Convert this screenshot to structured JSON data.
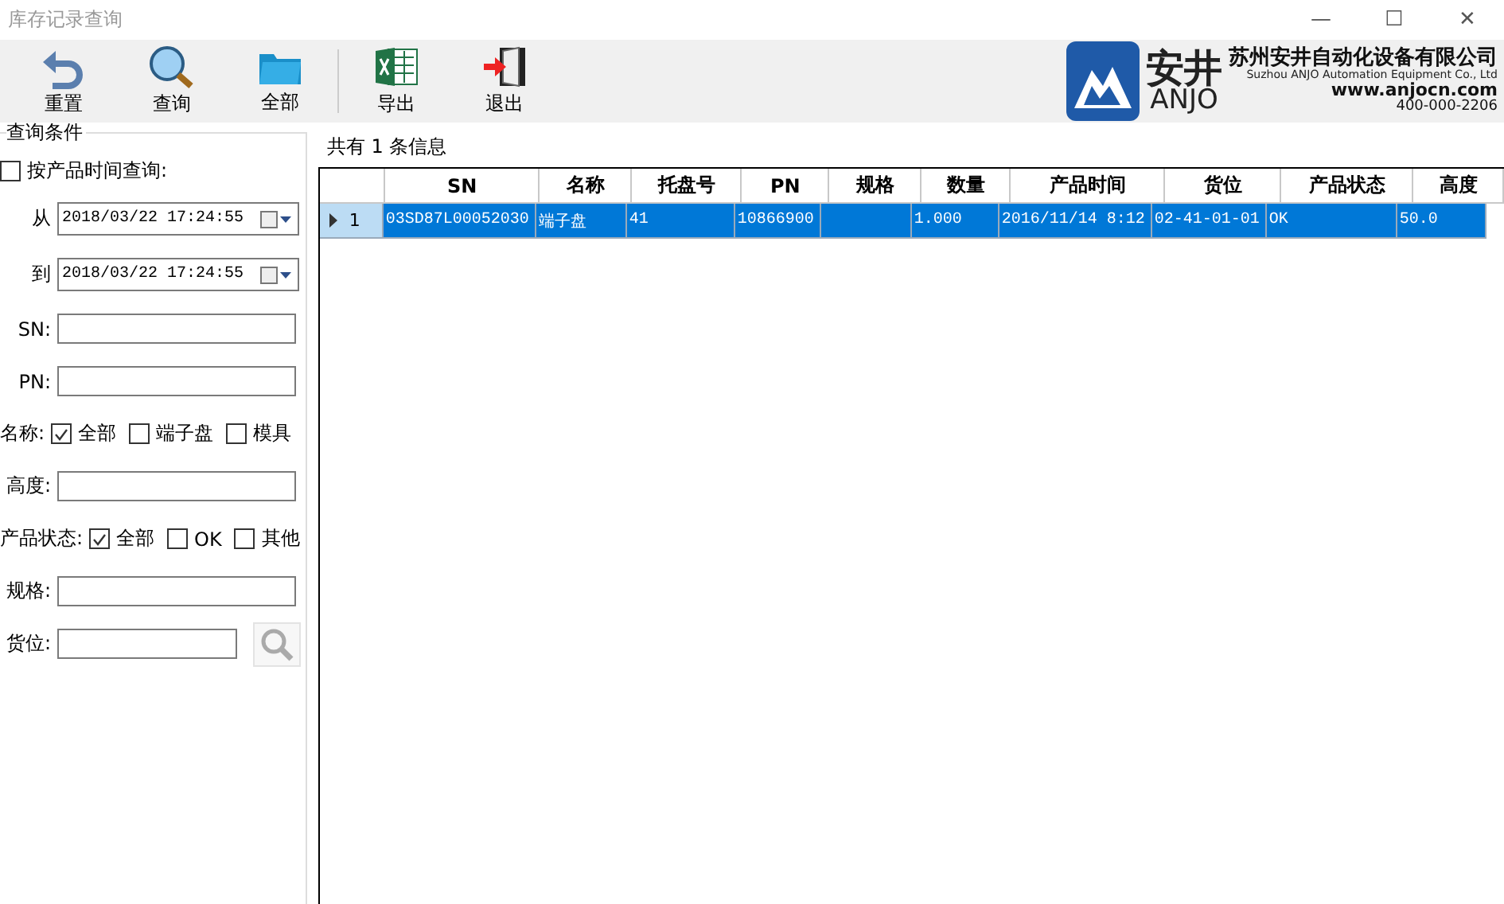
{
  "window": {
    "title": "库存记录查询",
    "controls": [
      "—",
      "☐",
      "✕"
    ]
  },
  "toolbar": [
    {
      "label": "重置",
      "kind": "reset"
    },
    {
      "label": "查询",
      "kind": "search"
    },
    {
      "label": "全部",
      "kind": "folder"
    },
    {
      "label": "导出",
      "kind": "excel"
    },
    {
      "label": "退出",
      "kind": "exit"
    }
  ],
  "logo": {
    "mark": "安井",
    "latin": "ANJO",
    "company": "苏州安井自动化设备有限公司",
    "company_en": "Suzhou ANJO Automation Equipment Co., Ltd",
    "url": "www.anjocn.com",
    "phone": "400-000-2206"
  },
  "filters": {
    "title": "查询条件",
    "by_time": {
      "label": "按产品时间查询:",
      "checked": false
    },
    "from": {
      "label": "从",
      "value": "2018/03/22 17:24:55"
    },
    "to": {
      "label": "到",
      "value": "2018/03/22 17:24:55"
    },
    "fields": [
      {
        "label": "SN:"
      },
      {
        "label": "PN:"
      }
    ],
    "name": {
      "label": "名称:",
      "options": [
        {
          "label": "全部",
          "checked": true
        },
        {
          "label": "端子盘",
          "checked": false
        },
        {
          "label": "模具",
          "checked": false
        }
      ]
    },
    "height": {
      "label": "高度:"
    },
    "status": {
      "label": "产品状态:",
      "options": [
        {
          "label": "全部",
          "checked": true
        },
        {
          "label": "OK",
          "checked": false
        },
        {
          "label": "其他",
          "checked": false
        }
      ]
    },
    "spec": {
      "label": "规格:"
    },
    "location": {
      "label": "货位:"
    }
  },
  "summary": "共有 1 条信息",
  "table": {
    "columns": [
      "SN",
      "名称",
      "托盘号",
      "PN",
      "规格",
      "数量",
      "产品时间",
      "货位",
      "产品状态",
      "高度"
    ],
    "rows": [
      {
        "index": "1",
        "selected": true,
        "cells": [
          "03SD87L00052030",
          "端子盘",
          "41",
          "10866900",
          "",
          "1.000",
          "2016/11/14 8:12",
          "02-41-01-01",
          "OK",
          "50.0"
        ]
      }
    ]
  }
}
